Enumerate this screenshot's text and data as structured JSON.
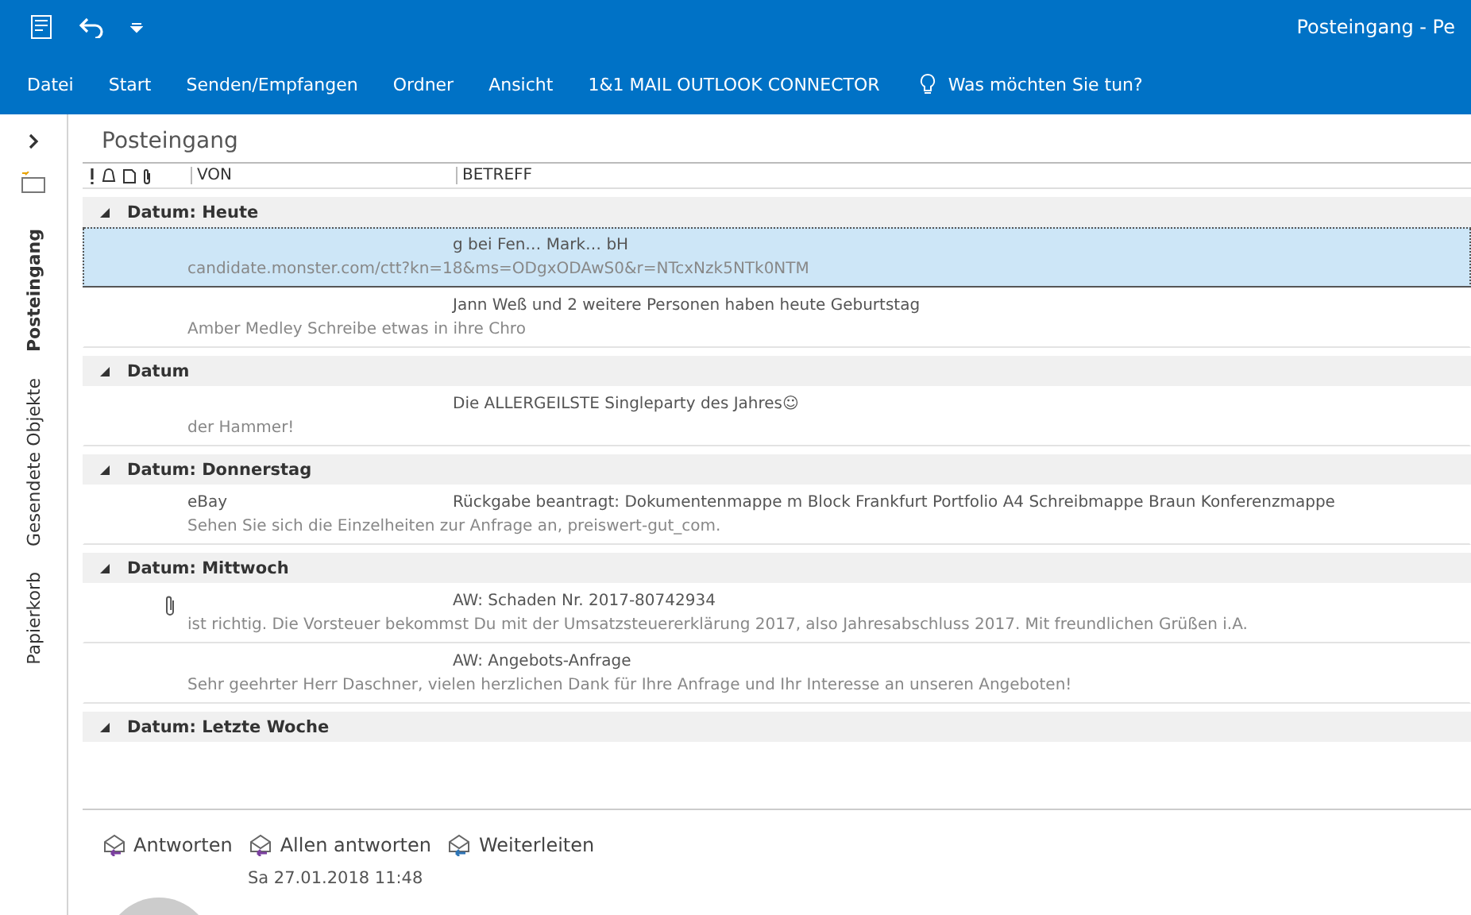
{
  "window": {
    "title": "Posteingang - Pe"
  },
  "ribbon_tabs": [
    {
      "label": "Datei",
      "selected": false
    },
    {
      "label": "Start",
      "selected": false
    },
    {
      "label": "Senden/Empfangen",
      "selected": false
    },
    {
      "label": "Ordner",
      "selected": false
    },
    {
      "label": "Ansicht",
      "selected": false
    },
    {
      "label": "1&1 MAIL OUTLOOK CONNECTOR",
      "selected": false
    }
  ],
  "tell_me": {
    "placeholder": "Was möchten Sie tun?"
  },
  "folder_tabs": [
    {
      "label": "Posteingang",
      "selected": true
    },
    {
      "label": "Gesendete Objekte",
      "selected": false
    },
    {
      "label": "Papierkorb",
      "selected": false
    }
  ],
  "folder_title": "Posteingang",
  "columns": [
    "VON",
    "BETREFF"
  ],
  "groups": [
    {
      "label": "Datum: Heute",
      "expanded": true,
      "messages": [
        {
          "subject": "g bei Fen…  Mark…  bH",
          "preview": "candidate.monster.com/ctt?kn=18&ms=ODgxODAwS0&r=NTcxNzk5NTk0NTM",
          "selected": true,
          "attachment": false
        },
        {
          "subject": "Jann Weß und 2 weitere Personen haben heute Geburtstag",
          "preview": "Amber Medley   Schreibe etwas in ihre Chro",
          "selected": false,
          "attachment": false
        }
      ]
    },
    {
      "label": "Datum",
      "expanded": true,
      "messages": [
        {
          "subject": "Die ALLERGEILSTE Singleparty des Jahres☺",
          "preview": "der Hammer!",
          "selected": false,
          "attachment": false
        }
      ]
    },
    {
      "label": "Datum: Donnerstag",
      "expanded": true,
      "messages": [
        {
          "from": "eBay",
          "subject": "Rückgabe beantragt: Dokumentenmappe m Block Frankfurt Portfolio A4 Schreibmappe Braun Konferenzmappe",
          "preview": "Sehen Sie sich die Einzelheiten zur Anfrage an, preiswert-gut_com.",
          "selected": false,
          "attachment": false
        }
      ]
    },
    {
      "label": "Datum: Mittwoch",
      "expanded": true,
      "messages": [
        {
          "subject": "AW: Schaden Nr. 2017-80742934",
          "preview": "ist richtig.   Die Vorsteuer bekommst Du mit der Umsatzsteuererklärung 2017,  also Jahresabschluss 2017.  Mit freundlichen Grüßen  i.A.",
          "selected": false,
          "attachment": true
        },
        {
          "subject": "AW: Angebots-Anfrage",
          "preview": "Sehr geehrter Herr Daschner,  vielen herzlichen Dank für Ihre Anfrage und Ihr Interesse an unseren Angeboten!",
          "selected": false,
          "attachment": false
        }
      ]
    },
    {
      "label": "Datum: Letzte Woche",
      "expanded": true
    }
  ],
  "reading_pane": {
    "actions": [
      "Antworten",
      "Allen antworten",
      "Weiterleiten"
    ],
    "date": "Sa 27.01.2018 11:48"
  }
}
